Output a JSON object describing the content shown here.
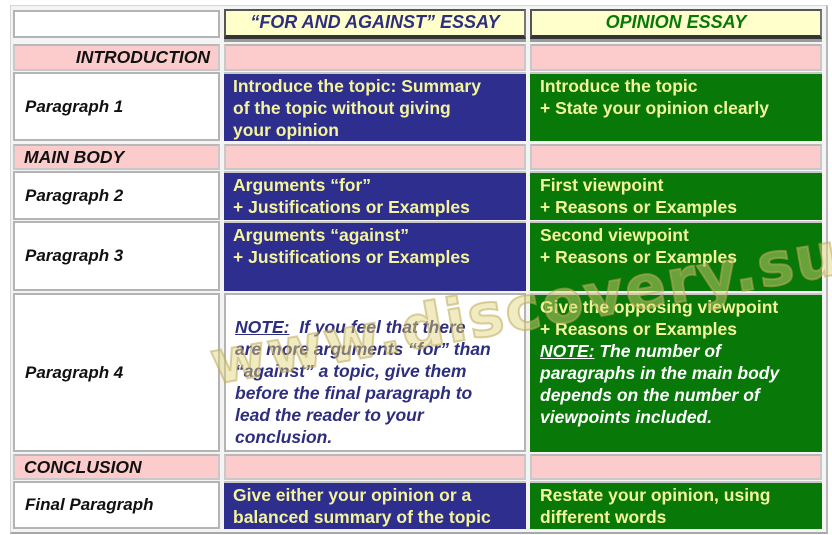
{
  "header": {
    "col1": "",
    "col2": "“FOR AND AGAINST” ESSAY",
    "col3": "OPINION ESSAY",
    "col2_color": "#2e2e7e",
    "col3_color": "#087808"
  },
  "sections": {
    "introduction": "INTRODUCTION",
    "main_body": "MAIN BODY",
    "conclusion": "CONCLUSION"
  },
  "rows": [
    {
      "label": "Paragraph 1",
      "for_against": [
        "Introduce the topic: Summary",
        "of the topic without giving",
        "your opinion"
      ],
      "opinion": [
        "Introduce the topic",
        "+ State your opinion clearly"
      ]
    },
    {
      "label": "Paragraph 2",
      "for_against": [
        "Arguments “for”",
        "+ Justifications or Examples"
      ],
      "opinion": [
        "First viewpoint",
        "+ Reasons or Examples"
      ]
    },
    {
      "label": "Paragraph 3",
      "for_against": [
        "Arguments “against”",
        "+ Justifications or Examples"
      ],
      "opinion": [
        "Second viewpoint",
        "+ Reasons or Examples"
      ]
    },
    {
      "label": "Paragraph 4",
      "for_against_note": {
        "prefix": "NOTE:",
        "text": [
          "If you feel that there",
          "are more arguments “for” than",
          "“against” a topic, give them",
          "before the final paragraph to",
          "lead the reader to your",
          "conclusion."
        ]
      },
      "opinion": [
        "Give the opposing viewpoint",
        "+ Reasons or Examples"
      ],
      "opinion_note": {
        "prefix": "NOTE:",
        "text": [
          "The number of",
          "paragraphs in the main body",
          "depends on the number of",
          "viewpoints included."
        ]
      }
    },
    {
      "label": "Final Paragraph",
      "for_against": [
        "Give either your opinion or a",
        "balanced summary of the topic"
      ],
      "opinion": [
        "Restate your opinion, using",
        "different words"
      ]
    }
  ],
  "watermark": "www.discovery.sumy.ua",
  "colors": {
    "for_against_bg": "#2e2e8e",
    "opinion_bg": "#087808",
    "cell_text": "#f4f49c",
    "section_bg": "#fccccc",
    "header_bg": "#ffffcc"
  }
}
